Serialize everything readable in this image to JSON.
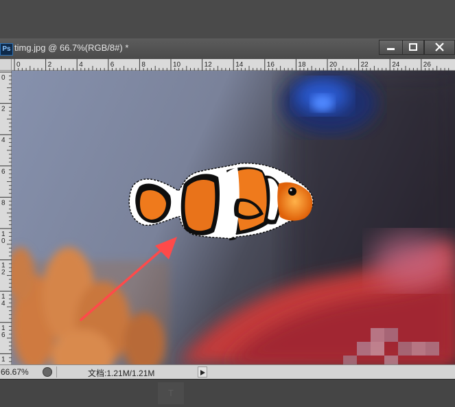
{
  "document": {
    "title": "timg.jpg @ 66.7%(RGB/8#) *",
    "app_badge": "Ps"
  },
  "window_controls": {
    "minimize_icon": "minimize-icon",
    "maximize_icon": "maximize-icon",
    "close_icon": "close-icon"
  },
  "rulers": {
    "top_labels": [
      "0",
      "2",
      "4",
      "6",
      "8",
      "10",
      "12",
      "14",
      "16",
      "18",
      "20",
      "22",
      "24",
      "26"
    ],
    "left_labels": [
      "0",
      "2",
      "4",
      "6",
      "8",
      "1 0",
      "1 2",
      "1 4",
      "1 6",
      "1"
    ]
  },
  "status": {
    "zoom": "66.67%",
    "doc_info": "文档:1.21M/1.21M",
    "menu_arrow_icon": "play-arrow-icon"
  },
  "colors": {
    "annotation_arrow": "#ff4a4a",
    "selection_border": "#000000"
  }
}
